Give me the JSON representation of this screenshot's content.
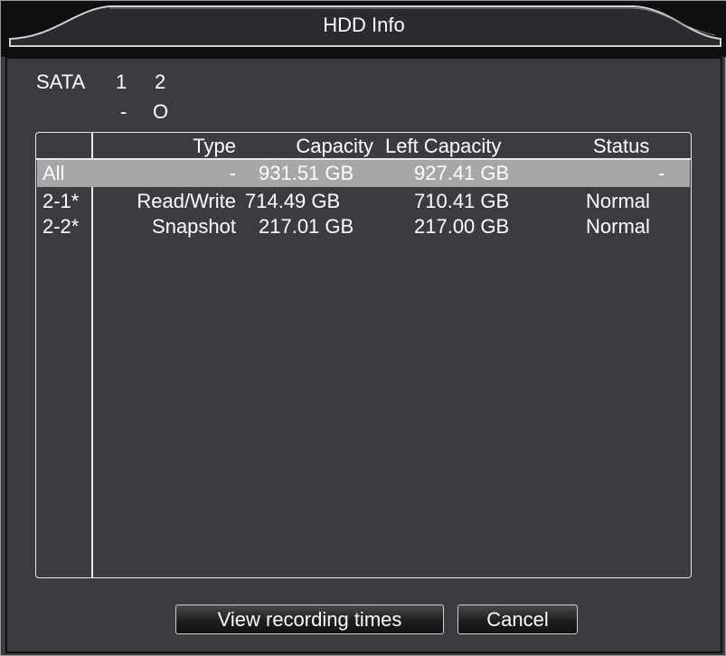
{
  "window": {
    "title": "HDD Info"
  },
  "sata": {
    "label": "SATA",
    "ports": [
      "1",
      "2"
    ],
    "port_status": [
      "-",
      "O"
    ]
  },
  "table": {
    "headers": {
      "id": "",
      "type": "Type",
      "capacity": "Capacity",
      "left_capacity": "Left Capacity",
      "status": "Status"
    },
    "rows": [
      {
        "id": "All",
        "type": "-",
        "capacity": "931.51 GB",
        "left_capacity": "927.41 GB",
        "status": "-"
      },
      {
        "id": "2-1*",
        "type": "Read/Write",
        "capacity": "714.49 GB",
        "left_capacity": "710.41 GB",
        "status": "Normal"
      },
      {
        "id": "2-2*",
        "type": "Snapshot",
        "capacity": "217.01 GB",
        "left_capacity": "217.00 GB",
        "status": "Normal"
      }
    ]
  },
  "buttons": {
    "view_recording_times": "View recording times",
    "cancel": "Cancel"
  },
  "colors": {
    "panel_bg": "#3b3c41",
    "selected_row": "#a7a7a7",
    "titlebar": "#111214"
  }
}
